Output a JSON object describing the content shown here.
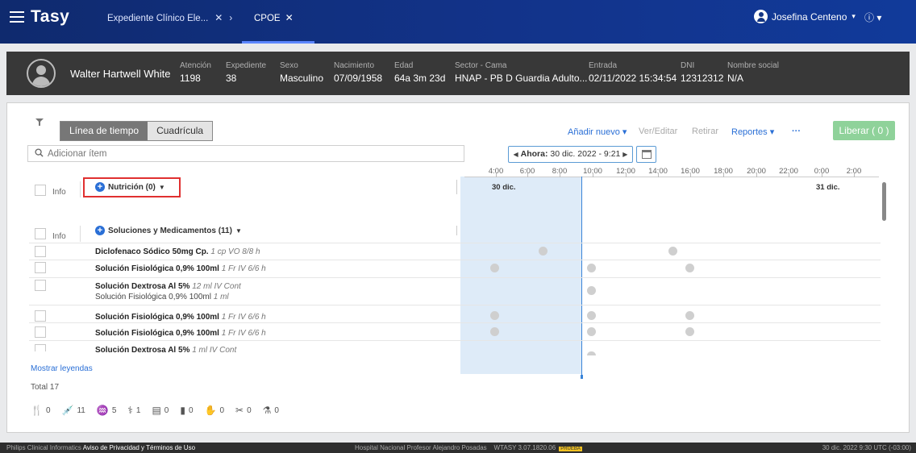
{
  "header": {
    "app_name": "Tasy",
    "tabs": [
      {
        "label": "Expediente Clínico Ele...",
        "close": "✕",
        "chevron": "›"
      },
      {
        "label": "CPOE",
        "close": "✕"
      }
    ],
    "user_name": "Josefina Centeno",
    "user_caret": "▾",
    "info_label": "ⓘ ▾"
  },
  "patient": {
    "name": "Walter Hartwell White",
    "fields": [
      {
        "label": "Atención",
        "value": "1198"
      },
      {
        "label": "Expediente",
        "value": "38"
      },
      {
        "label": "Sexo",
        "value": "Masculino"
      },
      {
        "label": "Nacimiento",
        "value": "07/09/1958"
      },
      {
        "label": "Edad",
        "value": "64a 3m 23d"
      },
      {
        "label": "Sector - Cama",
        "value": "HNAP - PB D Guardia Adulto..."
      },
      {
        "label": "Entrada",
        "value": "02/11/2022 15:34:54"
      },
      {
        "label": "DNI",
        "value": "12312312"
      },
      {
        "label": "Nombre social",
        "value": "N/A"
      }
    ]
  },
  "toolbar": {
    "view_timeline": "Línea de tiempo",
    "view_grid": "Cuadrícula",
    "add_new": "Añadir nuevo",
    "view_edit": "Ver/Editar",
    "remove": "Retirar",
    "reports": "Reportes",
    "more": "···",
    "release": "Liberar ( 0 )",
    "search_placeholder": "Adicionar ítem",
    "now_label": "Ahora:",
    "now_value": "30 dic. 2022 - 9:21"
  },
  "timeline": {
    "ticks": [
      "4:00",
      "6:00",
      "8:00",
      "10:00",
      "12:00",
      "14:00",
      "16:00",
      "18:00",
      "20:00",
      "22:00",
      "0:00",
      "2:00"
    ],
    "day1": "30 dic.",
    "day2": "31 dic."
  },
  "groups": {
    "info_label": "Info",
    "nutrition": "Nutrición (0)",
    "solutions": "Soluciones y Medicamentos (11)"
  },
  "rows": [
    {
      "name": "Diclofenaco Sódico 50mg Cp.",
      "detail": "1 cp VO 8/8 h"
    },
    {
      "name": "Solución Fisiológica 0,9% 100ml",
      "detail": "1 Fr IV 6/6 h"
    },
    {
      "name": "Solución Dextrosa Al 5%",
      "detail": "12 ml IV Cont",
      "sub_name": "Solución Fisiológica 0,9% 100ml",
      "sub_detail": "1 ml"
    },
    {
      "name": "Solución Fisiológica 0,9% 100ml",
      "detail": "1 Fr IV 6/6 h"
    },
    {
      "name": "Solución Fisiológica 0,9% 100ml",
      "detail": "1 Fr IV 6/6 h"
    },
    {
      "name": "Solución Dextrosa Al 5%",
      "detail": "1 ml IV Cont"
    }
  ],
  "summary": {
    "show_legends": "Mostrar leyendas",
    "total": "Total 17",
    "legend": [
      {
        "icon": "fork-knife-icon",
        "glyph": "🍴",
        "count": "0"
      },
      {
        "icon": "syringe-icon",
        "glyph": "💉",
        "count": "11"
      },
      {
        "icon": "lungs-icon",
        "glyph": "♒",
        "count": "5"
      },
      {
        "icon": "bed-icon",
        "glyph": "⚕",
        "count": "1"
      },
      {
        "icon": "document-icon",
        "glyph": "▤",
        "count": "0"
      },
      {
        "icon": "blood-bag-icon",
        "glyph": "▮",
        "count": "0"
      },
      {
        "icon": "hand-icon",
        "glyph": "✋",
        "count": "0"
      },
      {
        "icon": "scissors-icon",
        "glyph": "✂",
        "count": "0"
      },
      {
        "icon": "flask-icon",
        "glyph": "⚗",
        "count": "0"
      }
    ]
  },
  "footer": {
    "company": "Philips Clinical Informatics",
    "privacy": "Aviso de Privacidad y Términos de Uso",
    "hospital": "Hospital Nacional Profesor Alejandro Posadas",
    "version": "WTASY 3.07.1820.06",
    "env": "PRUEBA",
    "datetime": "30 dic. 2022   9:30   UTC (-03:00)"
  }
}
